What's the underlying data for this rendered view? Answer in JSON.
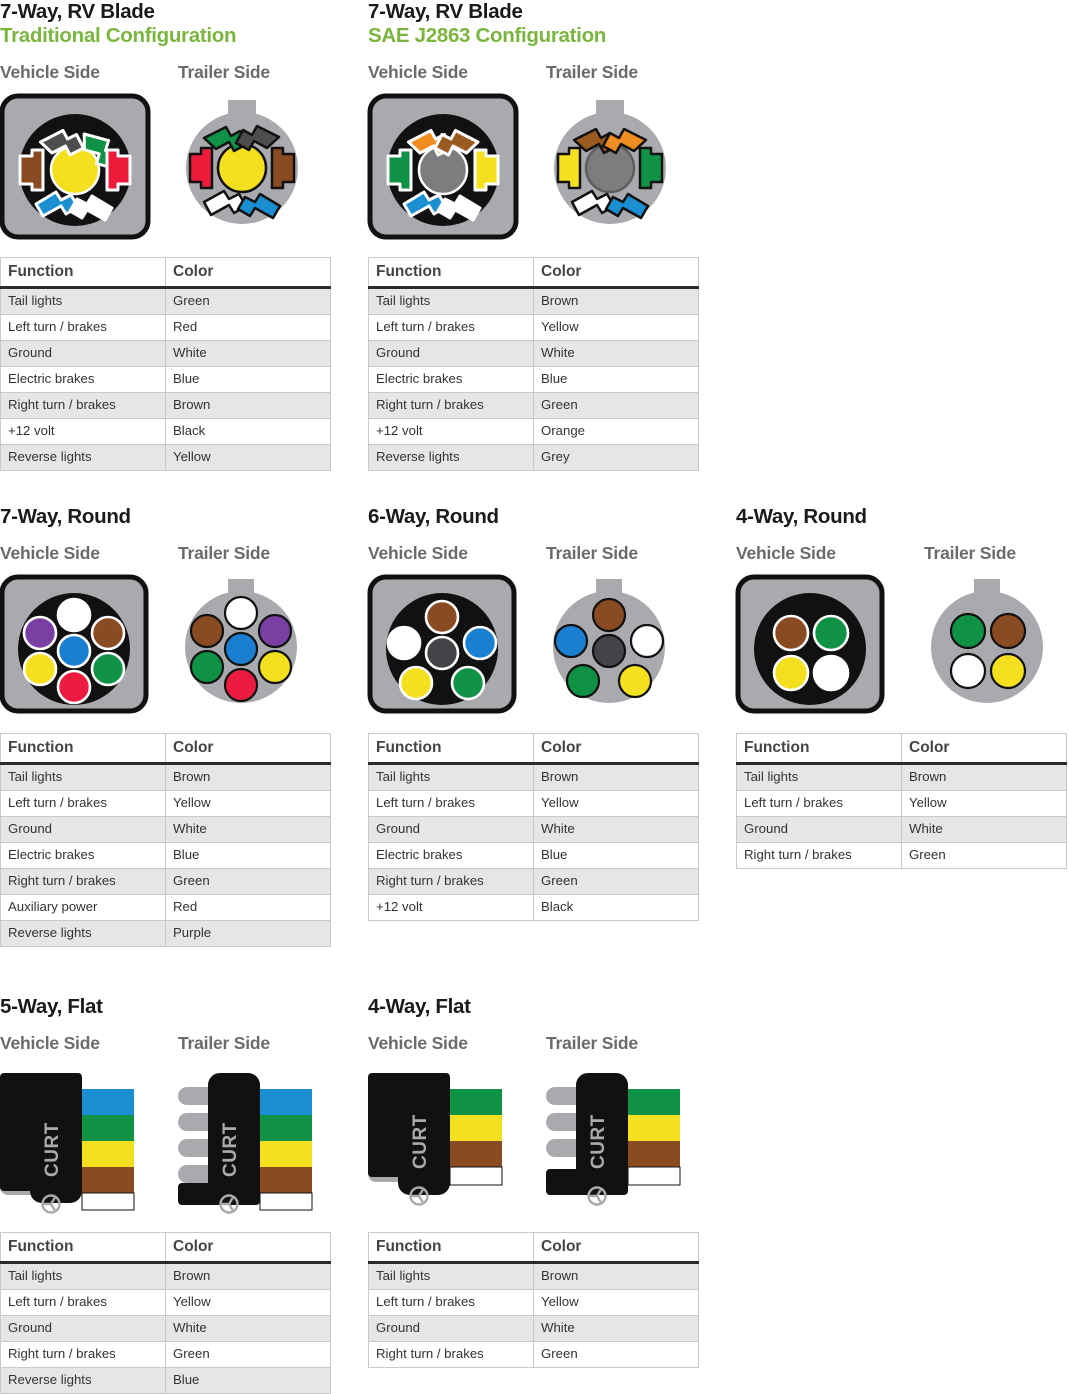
{
  "theme": {
    "accent_green": "#7ab63f",
    "heading_dark": "#1a1a1a",
    "side_label_grey": "#6b6b6b",
    "table_row_alt": "#e4e6e8",
    "connector_body_grey": "#a9aaad",
    "connector_black": "#111111"
  },
  "labels": {
    "vehicle_side": "Vehicle Side",
    "trailer_side": "Trailer Side",
    "col_function": "Function",
    "col_color": "Color",
    "brand": "CURT"
  },
  "connectors": [
    {
      "id": "7way-rv-blade-traditional",
      "title": "7-Way, RV Blade",
      "subtitle": "Traditional Configuration",
      "style": "blade",
      "center_pin": "#f5e020",
      "pins": [
        "#4d4d4d",
        "#0f9246",
        "#8a4b22",
        "#ec1c3a",
        "#1b8fd1",
        "#ffffff"
      ],
      "rows": [
        {
          "function": "Tail lights",
          "color": "Green"
        },
        {
          "function": "Left turn / brakes",
          "color": "Red"
        },
        {
          "function": "Ground",
          "color": "White"
        },
        {
          "function": "Electric brakes",
          "color": "Blue"
        },
        {
          "function": "Right turn / brakes",
          "color": "Brown"
        },
        {
          "function": "+12 volt",
          "color": "Black"
        },
        {
          "function": "Reverse lights",
          "color": "Yellow"
        }
      ]
    },
    {
      "id": "7way-rv-blade-sae-j2863",
      "title": "7-Way, RV Blade",
      "subtitle": "SAE J2863 Configuration",
      "style": "blade",
      "center_pin": "#7d7d80",
      "pins": [
        "#f08c22",
        "#9a5a20",
        "#0f9246",
        "#f5e020",
        "#1b8fd1",
        "#ffffff"
      ],
      "rows": [
        {
          "function": "Tail lights",
          "color": "Brown"
        },
        {
          "function": "Left turn / brakes",
          "color": "Yellow"
        },
        {
          "function": "Ground",
          "color": "White"
        },
        {
          "function": "Electric brakes",
          "color": "Blue"
        },
        {
          "function": "Right turn / brakes",
          "color": "Green"
        },
        {
          "function": "+12 volt",
          "color": "Orange"
        },
        {
          "function": "Reverse lights",
          "color": "Grey"
        }
      ]
    },
    {
      "id": "7way-round",
      "title": "7-Way, Round",
      "subtitle": null,
      "style": "round7",
      "pins": [
        "#ffffff",
        "#7a3fa3",
        "#8a4b22",
        "#1b7fd1",
        "#f5e020",
        "#0f9246",
        "#ee1b40"
      ],
      "rows": [
        {
          "function": "Tail lights",
          "color": "Brown"
        },
        {
          "function": "Left turn / brakes",
          "color": "Yellow"
        },
        {
          "function": "Ground",
          "color": "White"
        },
        {
          "function": "Electric brakes",
          "color": "Blue"
        },
        {
          "function": "Right turn / brakes",
          "color": "Green"
        },
        {
          "function": "Auxiliary power",
          "color": "Red"
        },
        {
          "function": "Reverse lights",
          "color": "Purple"
        }
      ]
    },
    {
      "id": "6way-round",
      "title": "6-Way, Round",
      "subtitle": null,
      "style": "round6",
      "pins": [
        "#8a4b22",
        "#ffffff",
        "#1b7fd1",
        "#444448",
        "#f5e020",
        "#0f9246"
      ],
      "rows": [
        {
          "function": "Tail lights",
          "color": "Brown"
        },
        {
          "function": "Left turn / brakes",
          "color": "Yellow"
        },
        {
          "function": "Ground",
          "color": "White"
        },
        {
          "function": "Electric brakes",
          "color": "Blue"
        },
        {
          "function": "Right turn / brakes",
          "color": "Green"
        },
        {
          "function": "+12 volt",
          "color": "Black"
        }
      ]
    },
    {
      "id": "4way-round",
      "title": "4-Way, Round",
      "subtitle": null,
      "style": "round4",
      "pins": [
        "#8a4b22",
        "#0f9246",
        "#f5e020",
        "#ffffff"
      ],
      "rows": [
        {
          "function": "Tail lights",
          "color": "Brown"
        },
        {
          "function": "Left turn / brakes",
          "color": "Yellow"
        },
        {
          "function": "Ground",
          "color": "White"
        },
        {
          "function": "Right turn / brakes",
          "color": "Green"
        }
      ]
    },
    {
      "id": "5way-flat",
      "title": "5-Way, Flat",
      "subtitle": null,
      "style": "flat5",
      "wires": [
        "#1b8fd1",
        "#0f9246",
        "#f5e020",
        "#8a4b22",
        "#ffffff"
      ],
      "rows": [
        {
          "function": "Tail lights",
          "color": "Brown"
        },
        {
          "function": "Left turn / brakes",
          "color": "Yellow"
        },
        {
          "function": "Ground",
          "color": "White"
        },
        {
          "function": "Right turn / brakes",
          "color": "Green"
        },
        {
          "function": "Reverse lights",
          "color": "Blue"
        }
      ]
    },
    {
      "id": "4way-flat",
      "title": "4-Way, Flat",
      "subtitle": null,
      "style": "flat4",
      "wires": [
        "#0f9246",
        "#f5e020",
        "#8a4b22",
        "#ffffff"
      ],
      "rows": [
        {
          "function": "Tail lights",
          "color": "Brown"
        },
        {
          "function": "Left turn / brakes",
          "color": "Yellow"
        },
        {
          "function": "Ground",
          "color": "White"
        },
        {
          "function": "Right turn / brakes",
          "color": "Green"
        }
      ]
    }
  ]
}
